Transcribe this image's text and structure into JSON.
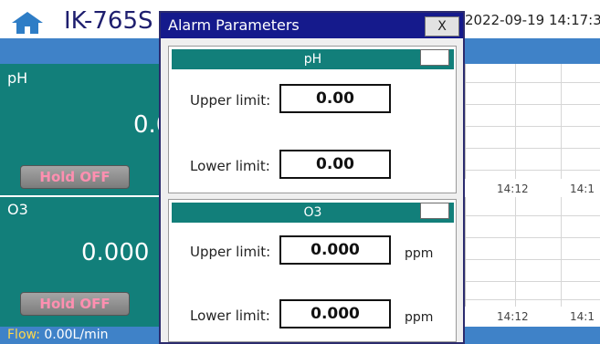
{
  "app": {
    "title": "IK-765S",
    "datetime": "2022-09-19 14:17:3"
  },
  "panels": [
    {
      "label": "pH",
      "value": "0.0",
      "hold": "Hold OFF"
    },
    {
      "label": "O3",
      "value": "0.000",
      "hold": "Hold OFF"
    }
  ],
  "flow": {
    "label": "Flow:",
    "value": "0.00L/min"
  },
  "charts": [
    {
      "ticks": [
        "14:12",
        "14:1"
      ]
    },
    {
      "ticks": [
        "14:12",
        "14:1"
      ]
    }
  ],
  "dialog": {
    "title": "Alarm Parameters",
    "close_label": "X",
    "groups": [
      {
        "name": "pH",
        "upper_label": "Upper limit:",
        "upper_value": "0.00",
        "lower_label": "Lower limit:",
        "lower_value": "0.00",
        "unit": ""
      },
      {
        "name": "O3",
        "upper_label": "Upper limit:",
        "upper_value": "0.000",
        "lower_label": "Lower limit:",
        "lower_value": "0.000",
        "unit": "ppm"
      }
    ]
  },
  "colors": {
    "teal": "#127f7a",
    "navy": "#151a8c",
    "band_blue": "#3f82c8"
  }
}
